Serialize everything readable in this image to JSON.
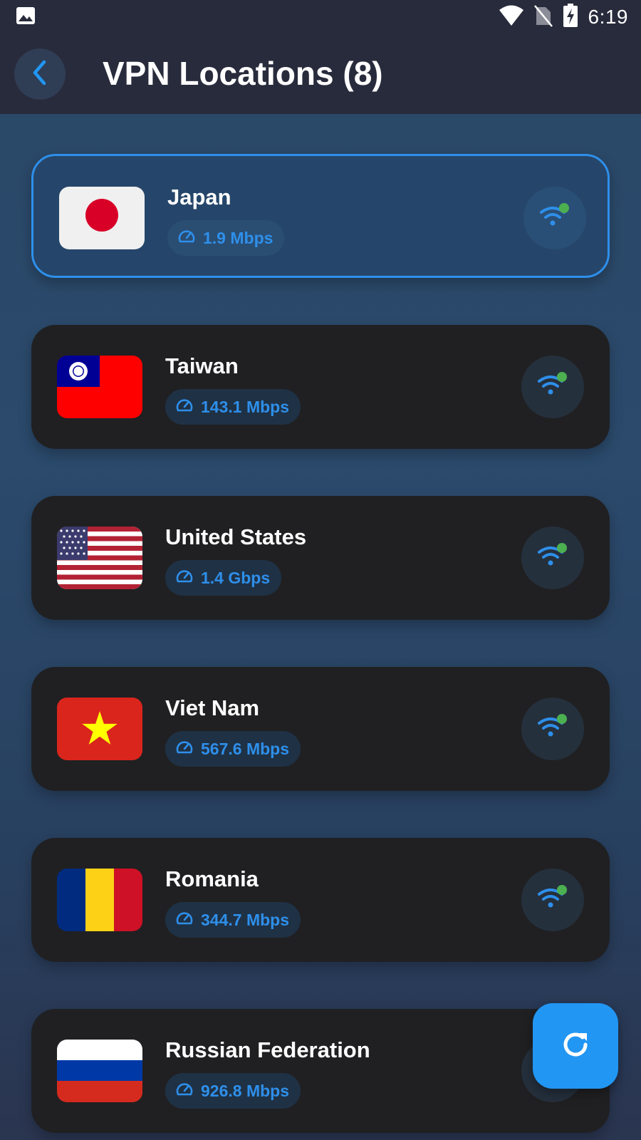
{
  "status_bar": {
    "time": "6:19",
    "icons": [
      "image-icon",
      "wifi-icon",
      "no-sim-icon",
      "battery-charging-icon"
    ]
  },
  "header": {
    "title": "VPN Locations (8)",
    "back_icon": "chevron-left-icon"
  },
  "locations": [
    {
      "name": "Japan",
      "speed": "1.9 Mbps",
      "flag": "japan",
      "selected": true
    },
    {
      "name": "Taiwan",
      "speed": "143.1 Mbps",
      "flag": "taiwan",
      "selected": false
    },
    {
      "name": "United States",
      "speed": "1.4 Gbps",
      "flag": "usa",
      "selected": false
    },
    {
      "name": "Viet Nam",
      "speed": "567.6 Mbps",
      "flag": "vietnam",
      "selected": false
    },
    {
      "name": "Romania",
      "speed": "344.7 Mbps",
      "flag": "romania",
      "selected": false
    },
    {
      "name": "Russian Federation",
      "speed": "926.8 Mbps",
      "flag": "russia",
      "selected": false
    }
  ],
  "fab": {
    "icon": "refresh-icon"
  },
  "colors": {
    "accent": "#2e8fea",
    "online_dot": "#4caf50",
    "fab": "#2196f3"
  }
}
